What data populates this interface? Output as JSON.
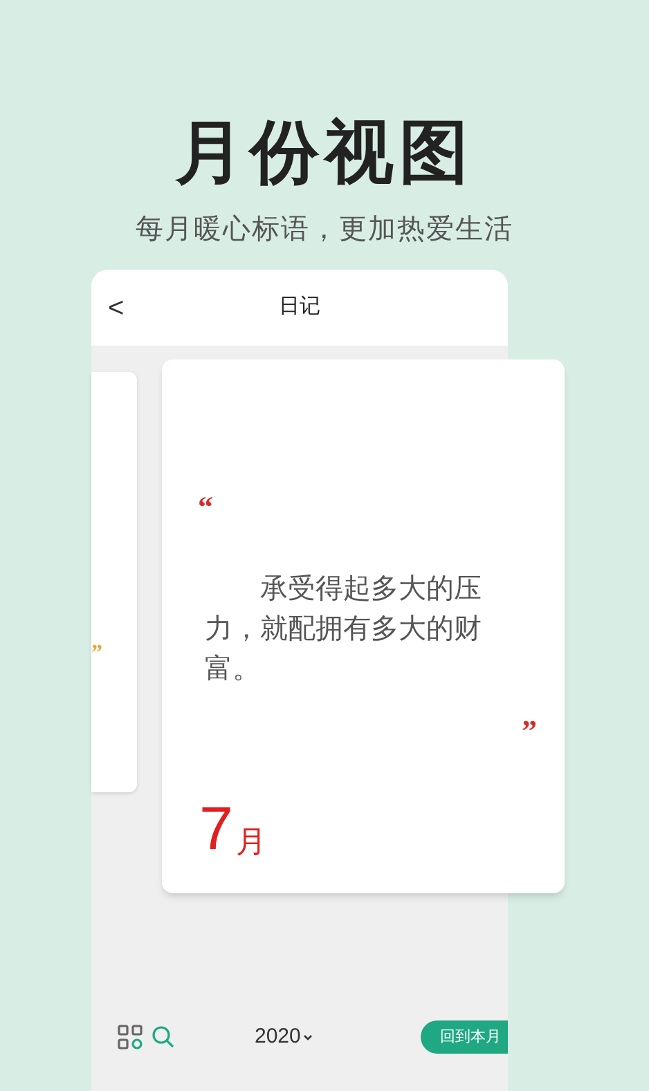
{
  "headline": "月份视图",
  "subtitle": "每月暖心标语，更加热爱生活",
  "phone": {
    "title": "日记",
    "back": "<",
    "cards": [
      {
        "kind": "peek",
        "close_quote": "”"
      },
      {
        "kind": "main",
        "open_quote": "“",
        "quote": "承受得起多大的压力，就配拥有多大的财富。",
        "close_quote": "”",
        "month_number": "7",
        "month_unit": "月"
      }
    ],
    "year": "2020",
    "today_button": "回到本月"
  }
}
